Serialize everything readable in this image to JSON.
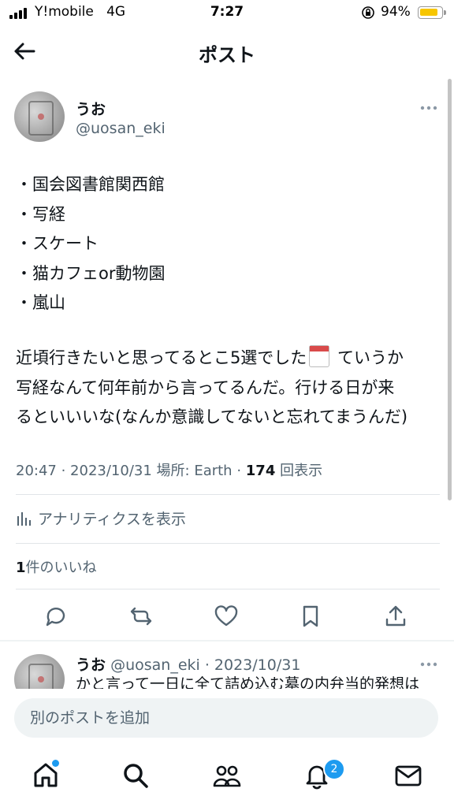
{
  "status_bar": {
    "carrier": "Y!mobile",
    "network": "4G",
    "time": "7:27",
    "battery": "94%",
    "battery_level": 0.94
  },
  "header": {
    "title": "ポスト"
  },
  "post": {
    "author_name": "うお",
    "author_handle": "@uosan_eki",
    "list": [
      "・国会図書館関西館",
      "・写経",
      "・スケート",
      "・猫カフェor動物園",
      "・嵐山"
    ],
    "body_lines": [
      {
        "before": "近頃行きたいと思ってるとこ5選でした",
        "after": " ていうか"
      },
      {
        "text": "写経なんて何年前から言ってるんだ。行ける日が来"
      },
      {
        "text": "るといいいな(なんか意識してないと忘れてまうんだ)"
      }
    ],
    "emoji": "calendar-icon",
    "time": "20:47",
    "date": "2023/10/31",
    "location": "場所: Earth",
    "view_count": "174",
    "views_label": "回表示",
    "analytics_label": "アナリティクスを表示",
    "like_count": "1",
    "like_label": "件のいいね"
  },
  "reply": {
    "author_name": "うお",
    "author_handle": "@uosan_eki",
    "date": "2023/10/31",
    "text": "かと言って一日に全て詰め込む墓の内弁当的発想は"
  },
  "composer": {
    "placeholder": "別のポストを追加"
  },
  "tabbar": {
    "notification_badge": "2"
  },
  "colors": {
    "accent": "#1d9bf0",
    "text": "#0f1419",
    "secondary": "#536471",
    "battery": "#f7c600"
  }
}
